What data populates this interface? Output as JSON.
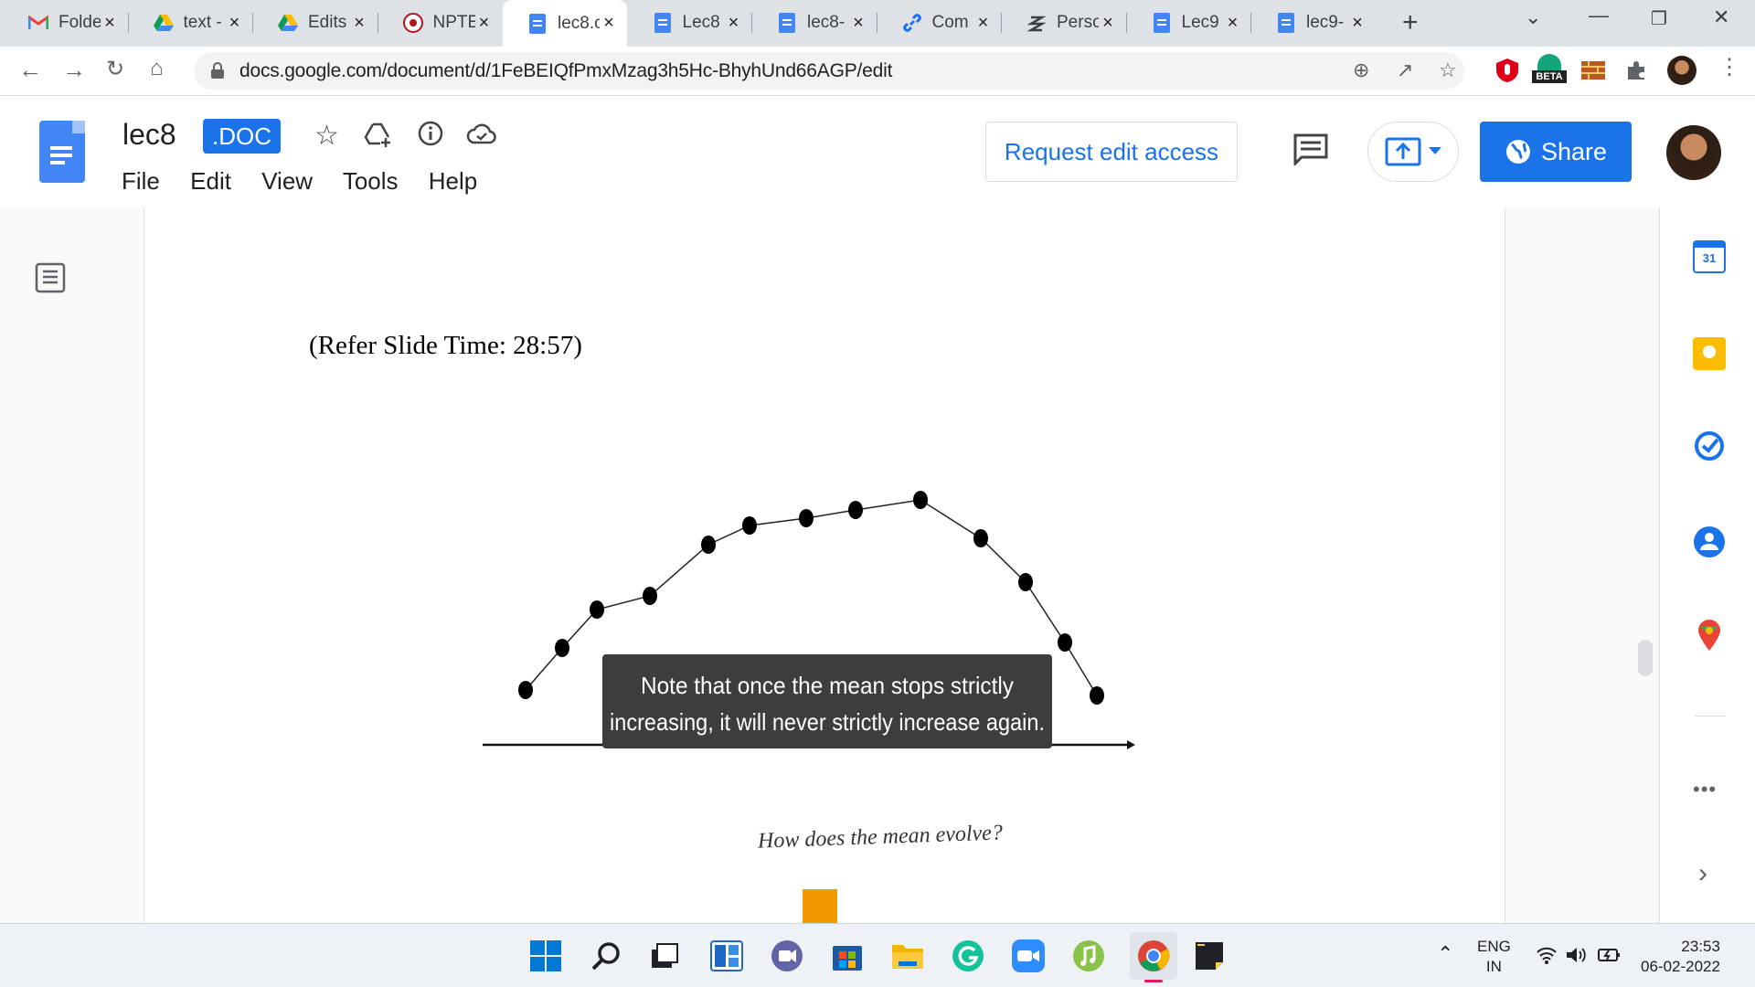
{
  "tabs": [
    {
      "label": "Folde",
      "icon": "gmail-icon"
    },
    {
      "label": "text -",
      "icon": "drive-icon"
    },
    {
      "label": "Edits",
      "icon": "drive-icon"
    },
    {
      "label": "NPTE",
      "icon": "nptel-icon"
    },
    {
      "label": "lec8.c",
      "icon": "docs-icon",
      "active": true
    },
    {
      "label": "Lec8",
      "icon": "docs-icon"
    },
    {
      "label": "lec8-",
      "icon": "docs-icon"
    },
    {
      "label": "Com",
      "icon": "link-icon"
    },
    {
      "label": "Perso",
      "icon": "perso-icon"
    },
    {
      "label": "Lec9",
      "icon": "docs-icon"
    },
    {
      "label": "lec9-",
      "icon": "docs-icon"
    }
  ],
  "browser": {
    "url": "docs.google.com/document/d/1FeBEIQfPmxMzag3h5Hc-BhyhUnd66AGP/edit",
    "ext_badge": "BETA"
  },
  "docs": {
    "title": "lec8",
    "badge": ".DOC",
    "menus": [
      "File",
      "Edit",
      "View",
      "Tools",
      "Help"
    ],
    "request_label": "Request edit access",
    "share_label": "Share"
  },
  "content": {
    "slide_time": "(Refer Slide Time: 28:57)",
    "note_line1": "Note that once the mean stops strictly",
    "note_line2": "increasing, it will never strictly increase again.",
    "caption": "How does the mean evolve?"
  },
  "side_calendar": "31",
  "taskbar": {
    "lang1": "ENG",
    "lang2": "IN",
    "time": "23:53",
    "date": "06-02-2022"
  }
}
